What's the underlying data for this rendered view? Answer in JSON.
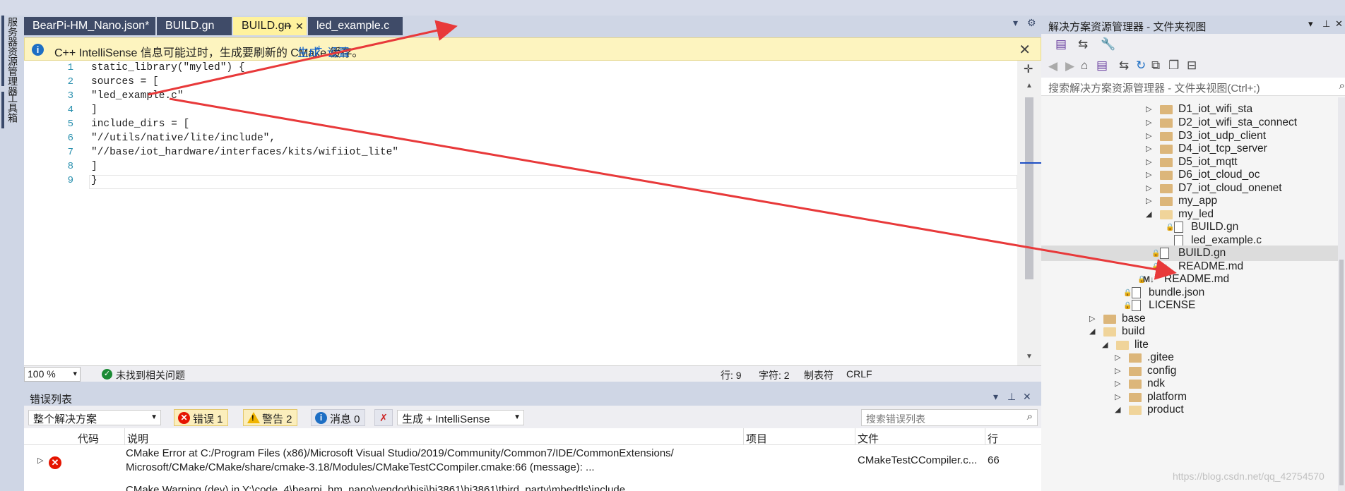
{
  "sidebar": {
    "tabs": [
      {
        "label": "服务器资源管理器"
      },
      {
        "label": "工具箱"
      }
    ]
  },
  "editor_tabs": [
    {
      "label": "BearPi-HM_Nano.json*"
    },
    {
      "label": "BUILD.gn"
    },
    {
      "label": "BUILD.gn",
      "active": true,
      "pin_icon": "pin-icon",
      "close_icon": "close-icon"
    },
    {
      "label": "led_example.c"
    }
  ],
  "infobar": {
    "message": "C++ IntelliSense 信息可能过时，生成要刷新的 CMake 缓存。",
    "link_generate": "生成",
    "link_plus": "+",
    "link_settings": "设置"
  },
  "code": {
    "line_numbers": [
      "1",
      "2",
      "3",
      "4",
      "5",
      "6",
      "7",
      "8",
      "9"
    ],
    "lines": [
      "static_library(\"myled\") {",
      "sources = [",
      "\"led_example.c\"",
      "]",
      "include_dirs = [",
      "\"//utils/native/lite/include\",",
      "\"//base/iot_hardware/interfaces/kits/wifiiot_lite\"",
      "]",
      "}"
    ]
  },
  "editor_status": {
    "zoom": "100 %",
    "no_issues": "未找到相关问题",
    "line": "行: 9",
    "col": "字符: 2",
    "tabs": "制表符",
    "eol": "CRLF"
  },
  "error_list": {
    "title": "错误列表",
    "scope": "整个解决方案",
    "errors_label": "错误 1",
    "warnings_label": "警告 2",
    "messages_label": "消息 0",
    "source_filter": "生成 + IntelliSense",
    "search_placeholder": "搜索错误列表",
    "columns": [
      "代码",
      "说明",
      "项目",
      "文件",
      "行"
    ],
    "row": {
      "desc_line1": "CMake Error at C:/Program Files (x86)/Microsoft Visual Studio/2019/Community/Common7/IDE/CommonExtensions/",
      "desc_line2": "Microsoft/CMake/CMake/share/cmake-3.18/Modules/CMakeTestCCompiler.cmake:66 (message): ...",
      "file": "CMakeTestCCompiler.c...",
      "line": "66",
      "next_desc": "CMake Warning (dev) in Y:\\code_4\\bearpi_hm_nano\\vendor\\hisi\\hi3861\\hi3861\\third_party\\mbedtls\\include"
    }
  },
  "solution_explorer": {
    "title": "解决方案资源管理器 - 文件夹视图",
    "search_placeholder": "搜索解决方案资源管理器 - 文件夹视图(Ctrl+;)",
    "nodes": [
      {
        "label": "D1_iot_wifi_sta",
        "type": "folder"
      },
      {
        "label": "D2_iot_wifi_sta_connect",
        "type": "folder"
      },
      {
        "label": "D3_iot_udp_client",
        "type": "folder"
      },
      {
        "label": "D4_iot_tcp_server",
        "type": "folder"
      },
      {
        "label": "D5_iot_mqtt",
        "type": "folder"
      },
      {
        "label": "D6_iot_cloud_oc",
        "type": "folder"
      },
      {
        "label": "D7_iot_cloud_onenet",
        "type": "folder"
      },
      {
        "label": "my_app",
        "type": "folder"
      },
      {
        "label": "my_led",
        "type": "folder-open"
      },
      {
        "label": "BUILD.gn",
        "type": "file"
      },
      {
        "label": "led_example.c",
        "type": "file"
      },
      {
        "label": "BUILD.gn",
        "type": "file"
      },
      {
        "label": "README.md",
        "type": "md"
      },
      {
        "label": "README.md",
        "type": "md"
      },
      {
        "label": "bundle.json",
        "type": "file"
      },
      {
        "label": "LICENSE",
        "type": "file"
      },
      {
        "label": "base",
        "type": "folder"
      },
      {
        "label": "build",
        "type": "folder-open"
      },
      {
        "label": "lite",
        "type": "folder-open"
      },
      {
        "label": ".gitee",
        "type": "folder"
      },
      {
        "label": "config",
        "type": "folder"
      },
      {
        "label": "ndk",
        "type": "folder"
      },
      {
        "label": "platform",
        "type": "folder"
      },
      {
        "label": "product",
        "type": "folder-open"
      }
    ]
  },
  "watermark": "https://blog.csdn.net/qq_42754570",
  "colors": {
    "annotation_arrow": "#e8393a",
    "active_tab": "#fff29d",
    "dark_tab": "#3f4b68",
    "infobar": "#fdf4bf"
  }
}
